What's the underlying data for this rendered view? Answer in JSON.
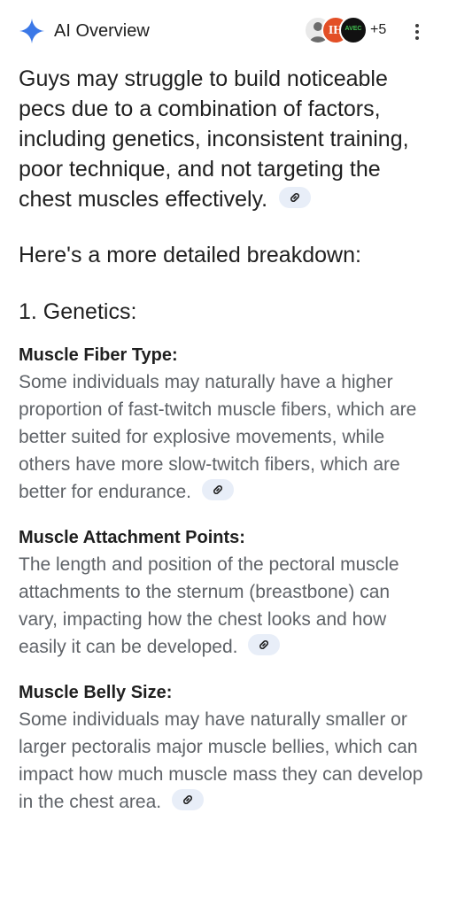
{
  "header": {
    "title": "AI Overview",
    "sources_more": "+5",
    "avatars": [
      {
        "icon": "person-photo-avatar"
      },
      {
        "text": "IH",
        "color": "#e34f26"
      },
      {
        "text": "AVEC",
        "color": "#111111"
      }
    ]
  },
  "main": {
    "intro": "Guys may struggle to build noticeable pecs due to a combination of factors, including genetics, inconsistent training, poor technique, and not targeting the chest muscles effectively.",
    "breakdown": "Here's a more detailed breakdown:",
    "section_heading": "1. Genetics:",
    "items": [
      {
        "title": "Muscle Fiber Type:",
        "body": "Some individuals may naturally have a higher proportion of fast-twitch muscle fibers, which are better suited for explosive movements, while others have more slow-twitch fibers, which are better for endurance."
      },
      {
        "title": "Muscle Attachment Points:",
        "body": "The length and position of the pectoral muscle attachments to the sternum (breastbone) can vary, impacting how the chest looks and how easily it can be developed."
      },
      {
        "title": "Muscle Belly Size:",
        "body": "Some individuals may have naturally smaller or larger pectoralis major muscle bellies, which can impact how much muscle mass they can develop in the chest area."
      }
    ]
  },
  "colors": {
    "spark_blue": "#3b78e7",
    "body_text": "#1f1f1f",
    "secondary_text": "#5f6368",
    "link_chip_bg": "#e8eef8"
  }
}
